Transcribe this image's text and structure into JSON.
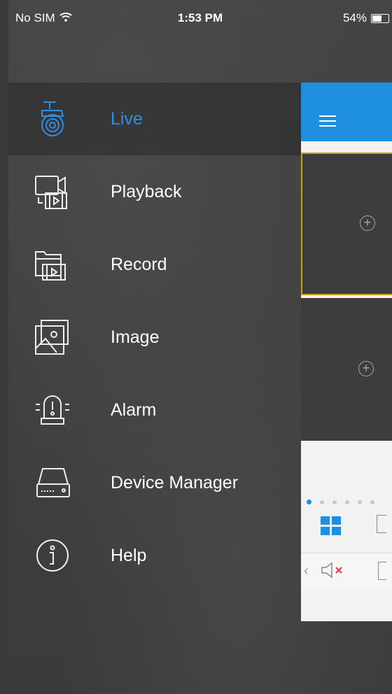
{
  "status_bar": {
    "carrier": "No SIM",
    "time": "1:53 PM",
    "battery": "54%"
  },
  "menu": {
    "items": [
      {
        "label": "Live",
        "icon": "camera-icon",
        "active": true
      },
      {
        "label": "Playback",
        "icon": "playback-icon",
        "active": false
      },
      {
        "label": "Record",
        "icon": "record-icon",
        "active": false
      },
      {
        "label": "Image",
        "icon": "image-icon",
        "active": false
      },
      {
        "label": "Alarm",
        "icon": "alarm-icon",
        "active": false
      },
      {
        "label": "Device Manager",
        "icon": "device-manager-icon",
        "active": false
      },
      {
        "label": "Help",
        "icon": "help-icon",
        "active": false
      }
    ]
  },
  "panel": {
    "accent_color": "#1e8fe1",
    "selected_border_color": "#c8a400",
    "page_dots": 6,
    "active_page": 0
  }
}
